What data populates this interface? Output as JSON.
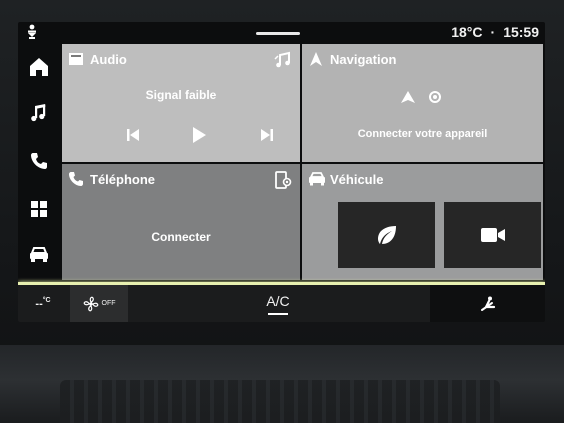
{
  "status": {
    "temperature": "18°C",
    "separator": "·",
    "time": "15:59"
  },
  "rail": {
    "items": [
      {
        "name": "home",
        "icon": "home-icon"
      },
      {
        "name": "music",
        "icon": "music-note-icon"
      },
      {
        "name": "phone",
        "icon": "phone-icon"
      },
      {
        "name": "apps",
        "icon": "apps-grid-icon"
      },
      {
        "name": "vehicle",
        "icon": "car-icon"
      }
    ],
    "accent": "#e8f0b0"
  },
  "tiles": {
    "audio": {
      "title": "Audio",
      "status": "Signal faible",
      "icon": "radio-icon",
      "source_icon": "music-source-icon"
    },
    "navigation": {
      "title": "Navigation",
      "message": "Connecter votre appareil",
      "icon": "navigation-arrow-icon"
    },
    "telephone": {
      "title": "Téléphone",
      "message": "Connecter",
      "icon": "phone-icon",
      "settings_icon": "phone-settings-icon"
    },
    "vehicle": {
      "title": "Véhicule",
      "icon": "car-icon",
      "cards": [
        {
          "icon": "eco-leaf-icon"
        },
        {
          "icon": "camera-icon"
        }
      ]
    }
  },
  "climate": {
    "temp_label": "--",
    "temp_unit": "°C",
    "fan_label": "OFF",
    "ac_label": "A/C"
  }
}
